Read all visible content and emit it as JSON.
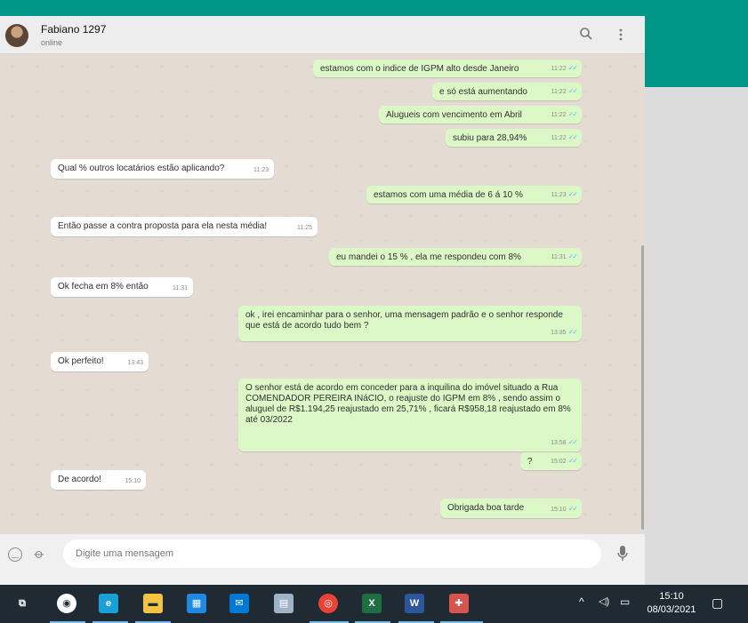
{
  "contact": {
    "name": "Fabiano 1297",
    "status": "online"
  },
  "composer": {
    "placeholder": "Digite uma mensagem"
  },
  "messages": [
    {
      "dir": "out",
      "text": "estamos com o indice de IGPM alto desde Janeiro",
      "time": "11:22"
    },
    {
      "dir": "out",
      "text": "e só está aumentando",
      "time": "11:22"
    },
    {
      "dir": "out",
      "text": "Alugueis com vencimento em Abril",
      "time": "11:22"
    },
    {
      "dir": "out",
      "text": "subiu para 28,94%",
      "time": "11:22"
    },
    {
      "dir": "in",
      "text": "Qual % outros locatários estão aplicando?",
      "time": "11:23"
    },
    {
      "dir": "out",
      "text": "estamos com uma média de 6 á 10 %",
      "time": "11:23"
    },
    {
      "dir": "in",
      "text": "Então passe a contra proposta para ela nesta média!",
      "time": "11:25"
    },
    {
      "dir": "out",
      "text": "eu mandei o 15 % , ela me respondeu com 8%",
      "time": "11:31"
    },
    {
      "dir": "in",
      "text": "Ok fecha em 8% então",
      "time": "11:31"
    },
    {
      "dir": "out",
      "text": "ok , irei encaminhar para o senhor, uma mensagem padrão e o senhor responde que está de acordo tudo bem ?",
      "time": "13:35"
    },
    {
      "dir": "in",
      "text": "Ok perfeito!",
      "time": "13:43"
    },
    {
      "dir": "out",
      "text": "O senhor está de acordo em conceder para a inquilina do imóvel situado a Rua COMENDADOR PEREIRA INáCIO, o reajuste do IGPM em 8% , sendo assim o aluguel de R$1.194,25 reajustado em 25,71% , ficará R$958,18 reajustado em 8% até 03/2022",
      "time": "13:58"
    },
    {
      "dir": "out",
      "text": "?",
      "time": "15:02"
    },
    {
      "dir": "in",
      "text": "De acordo!",
      "time": "15:10"
    },
    {
      "dir": "out",
      "text": "Obrigada boa tarde",
      "time": "15:10"
    }
  ],
  "taskbar": {
    "time": "15:10",
    "date": "08/03/2021",
    "apps": [
      {
        "name": "task-view",
        "glyph": "⧉"
      },
      {
        "name": "app-circle",
        "glyph": "◉"
      },
      {
        "name": "edge",
        "glyph": "e"
      },
      {
        "name": "file-explorer",
        "glyph": "▬"
      },
      {
        "name": "store",
        "glyph": "▦"
      },
      {
        "name": "mail",
        "glyph": "✉"
      },
      {
        "name": "app-cylinder",
        "glyph": "▤"
      },
      {
        "name": "chrome",
        "glyph": "◎"
      },
      {
        "name": "excel",
        "glyph": "X"
      },
      {
        "name": "word",
        "glyph": "W"
      },
      {
        "name": "app-red",
        "glyph": "✚"
      }
    ],
    "colors": [
      "#d0d7de",
      "#ffffff",
      "#1aa0d8",
      "#f5c342",
      "#1e88e5",
      "#0078d4",
      "#9fb3c8",
      "#ea4335",
      "#1d6f42",
      "#2b579a",
      "#d9534f"
    ]
  }
}
